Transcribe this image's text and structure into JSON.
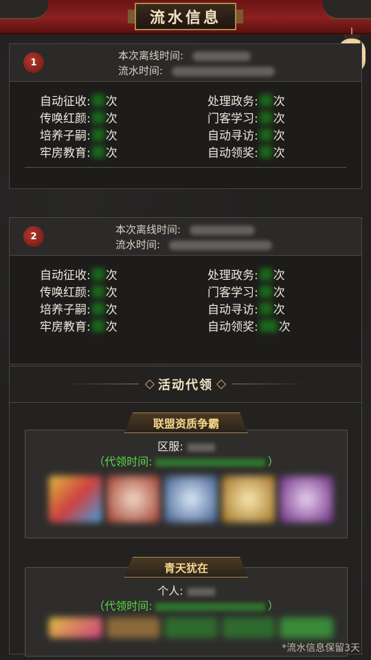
{
  "header": {
    "title": "流水信息",
    "back_icon": "back-arrow-icon"
  },
  "records": [
    {
      "index": "1",
      "offline_label": "本次离线时间:",
      "flow_label": "流水时间:",
      "stats_left": [
        {
          "label": "自动征收:",
          "unit": "次"
        },
        {
          "label": "传唤红颜:",
          "unit": "次"
        },
        {
          "label": "培养子嗣:",
          "unit": "次"
        },
        {
          "label": "牢房教育:",
          "unit": "次"
        }
      ],
      "stats_right": [
        {
          "label": "处理政务:",
          "unit": "次"
        },
        {
          "label": "门客学习:",
          "unit": "次"
        },
        {
          "label": "自动寻访:",
          "unit": "次"
        },
        {
          "label": "自动领奖:",
          "unit": "次"
        }
      ]
    },
    {
      "index": "2",
      "offline_label": "本次离线时间:",
      "flow_label": "流水时间:",
      "stats_left": [
        {
          "label": "自动征收:",
          "unit": "次"
        },
        {
          "label": "传唤红颜:",
          "unit": "次"
        },
        {
          "label": "培养子嗣:",
          "unit": "次"
        },
        {
          "label": "牢房教育:",
          "unit": "次"
        }
      ],
      "stats_right": [
        {
          "label": "处理政务:",
          "unit": "次"
        },
        {
          "label": "门客学习:",
          "unit": "次"
        },
        {
          "label": "自动寻访:",
          "unit": "次"
        },
        {
          "label": "自动领奖:",
          "unit": "次"
        }
      ]
    }
  ],
  "activity": {
    "title": "活动代领",
    "events": [
      {
        "name": "联盟资质争霸",
        "line1_label": "区服:",
        "line2_open": "（代领时间:",
        "line2_close": "）"
      },
      {
        "name": "青天犹在",
        "line1_label": "个人:",
        "line2_open": "（代领时间:",
        "line2_close": "）"
      }
    ]
  },
  "footer": {
    "note": "*流水信息保留3天"
  }
}
